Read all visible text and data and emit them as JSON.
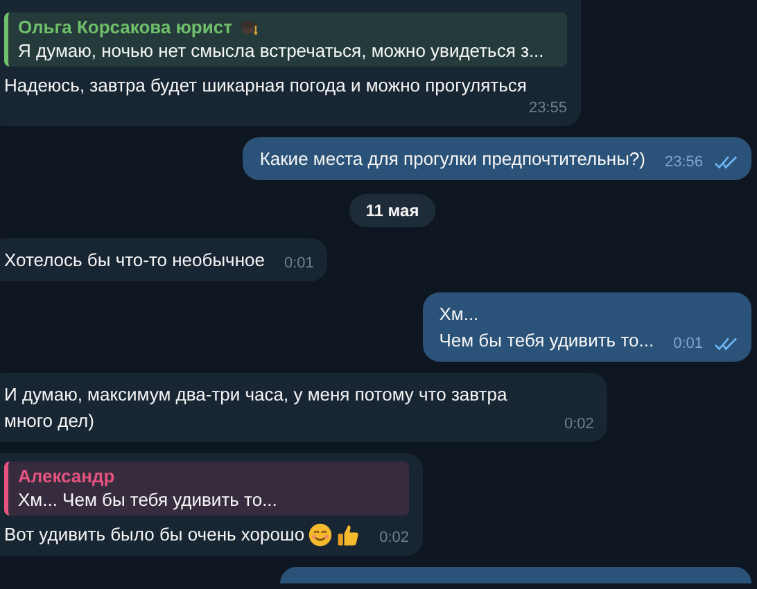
{
  "messages": [
    {
      "kind": "incoming",
      "reply": {
        "author": "Ольга Корсакова юрист",
        "text": "Я думаю, ночью нет смысла встречаться, можно увидеться з...",
        "color": "#6fbf6a",
        "kind": "badged"
      },
      "lines": [
        "Надеюсь, завтра будет шикарная погода и можно прогуляться"
      ],
      "time": "23:55"
    },
    {
      "kind": "outgoing",
      "lines": [
        "Какие места для прогулки предпочтительны?)"
      ],
      "time": "23:56",
      "read": true
    },
    {
      "kind": "date",
      "label": "11 мая"
    },
    {
      "kind": "incoming",
      "lines": [
        "Хотелось бы что-то необычное"
      ],
      "time": "0:01"
    },
    {
      "kind": "outgoing",
      "lines": [
        "Хм...",
        "Чем бы тебя удивить то..."
      ],
      "time": "0:01",
      "read": true
    },
    {
      "kind": "incoming",
      "lines": [
        "И думаю, максимум два-три часа, у меня потому что завтра много дел)"
      ],
      "time": "0:02"
    },
    {
      "kind": "incoming",
      "reply": {
        "author": "Александр",
        "text": "Хм...  Чем бы тебя удивить то...",
        "color": "#e5547e"
      },
      "lines": [
        "Вот удивить было бы очень хорошо"
      ],
      "emoji": true,
      "time": "0:02"
    },
    {
      "kind": "partial"
    }
  ]
}
